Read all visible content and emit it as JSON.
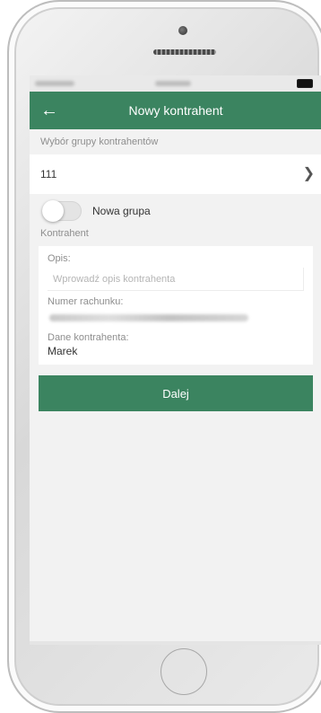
{
  "header": {
    "title": "Nowy kontrahent"
  },
  "group": {
    "section_label": "Wybór grupy kontrahentów",
    "value": "111",
    "new_group_toggle_label": "Nowa grupa",
    "new_group_toggle_on": false
  },
  "contractor": {
    "section_label": "Kontrahent",
    "opis_label": "Opis:",
    "opis_placeholder": "Wprowadź opis kontrahenta",
    "opis_value": "",
    "account_label": "Numer rachunku:",
    "dane_label": "Dane kontrahenta:",
    "dane_value": "Marek"
  },
  "actions": {
    "next_label": "Dalej"
  },
  "colors": {
    "brand_green": "#3b8460"
  },
  "icons": {
    "back": "arrow-left",
    "chevron": "chevron-right"
  }
}
